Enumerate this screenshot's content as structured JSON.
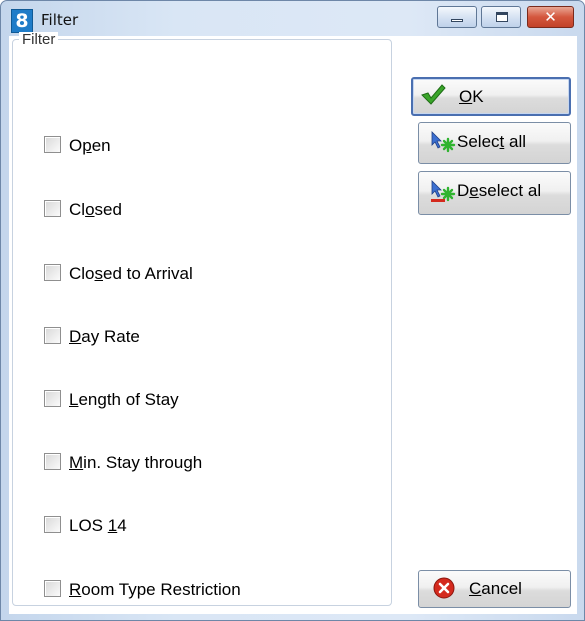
{
  "window": {
    "title": "Filter",
    "app_icon_text": "8",
    "close_glyph": "✕"
  },
  "group": {
    "legend": "Filter"
  },
  "filters": [
    {
      "label": "Open",
      "pre": "O",
      "ul": "p",
      "post": "en",
      "checked": false
    },
    {
      "label": "Closed",
      "pre": "Cl",
      "ul": "o",
      "post": "sed",
      "checked": false
    },
    {
      "label": "Closed to Arrival",
      "pre": "Clo",
      "ul": "s",
      "post": "ed to Arrival",
      "checked": false
    },
    {
      "label": "Day Rate",
      "pre": "",
      "ul": "D",
      "post": "ay Rate",
      "checked": false
    },
    {
      "label": "Length of Stay",
      "pre": "",
      "ul": "L",
      "post": "ength of Stay",
      "checked": false
    },
    {
      "label": "Min. Stay through",
      "pre": "",
      "ul": "M",
      "post": "in. Stay through",
      "checked": false
    },
    {
      "label": "LOS 14",
      "pre": "LOS ",
      "ul": "1",
      "post": "4",
      "checked": false
    },
    {
      "label": "Room Type Restriction",
      "pre": "",
      "ul": "R",
      "post": "oom Type Restriction",
      "checked": false
    }
  ],
  "buttons": {
    "ok": {
      "pre": "",
      "ul": "O",
      "post": "K"
    },
    "select_all": {
      "pre": "Selec",
      "ul": "t",
      "post": " all"
    },
    "deselect_all": {
      "pre": "D",
      "ul": "e",
      "post": "select al"
    },
    "cancel": {
      "pre": "",
      "ul": "C",
      "post": "ancel"
    }
  },
  "colors": {
    "title_gradient": "#d9e6f5",
    "ok_check": "#3aa52a",
    "cancel_icon": "#d42a1e",
    "select_star": "#2fb32f"
  }
}
